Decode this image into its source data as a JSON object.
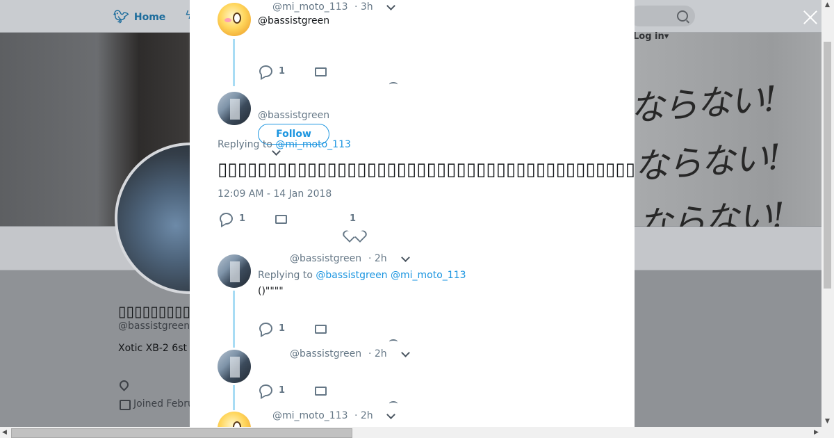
{
  "nav": {
    "home_label": "Home",
    "login_label": "Log in"
  },
  "profile": {
    "name": "▯▯▯▯▯▯▯▯▯▯",
    "handle": "@bassistgreen",
    "bio": "Xotic XB-2 6st",
    "joined": "Joined Febru"
  },
  "banner_text": "ならない!\nならない!\nならない!",
  "thread": {
    "tweet1": {
      "handle": "@mi_moto_113",
      "time": "· 3h",
      "text": "@bassistgreen",
      "reply_count": "1"
    },
    "main": {
      "handle": "@bassistgreen",
      "follow_label": "Follow",
      "replying_prefix": "Replying to",
      "replying_to": "@mi_moto_113",
      "text": "▯▯▯▯▯▯▯▯▯▯▯▯▯▯▯▯▯▯▯▯▯▯▯▯▯▯▯▯▯▯▯▯▯▯▯▯▯▯▯▯▯▯▯▯▯▯▯…etc▯▯▯▯▯",
      "timestamp": "12:09 AM - 14 Jan 2018",
      "reply_count": "1",
      "like_count": "1"
    },
    "tweet3": {
      "handle": "@bassistgreen",
      "time": "· 2h",
      "replying_prefix": "Replying to",
      "replying_to_1": "@bassistgreen",
      "replying_to_2": "@mi_moto_113",
      "text": "()\"\"\"\"",
      "reply_count": "1"
    },
    "tweet4": {
      "handle": "@bassistgreen",
      "time": "· 2h",
      "reply_count": "1"
    },
    "tweet5": {
      "handle": "@mi_moto_113",
      "time": "· 2h"
    }
  },
  "colors": {
    "accent": "#1b95e0",
    "thread_line": "#a8dcf4",
    "muted": "#657786"
  }
}
